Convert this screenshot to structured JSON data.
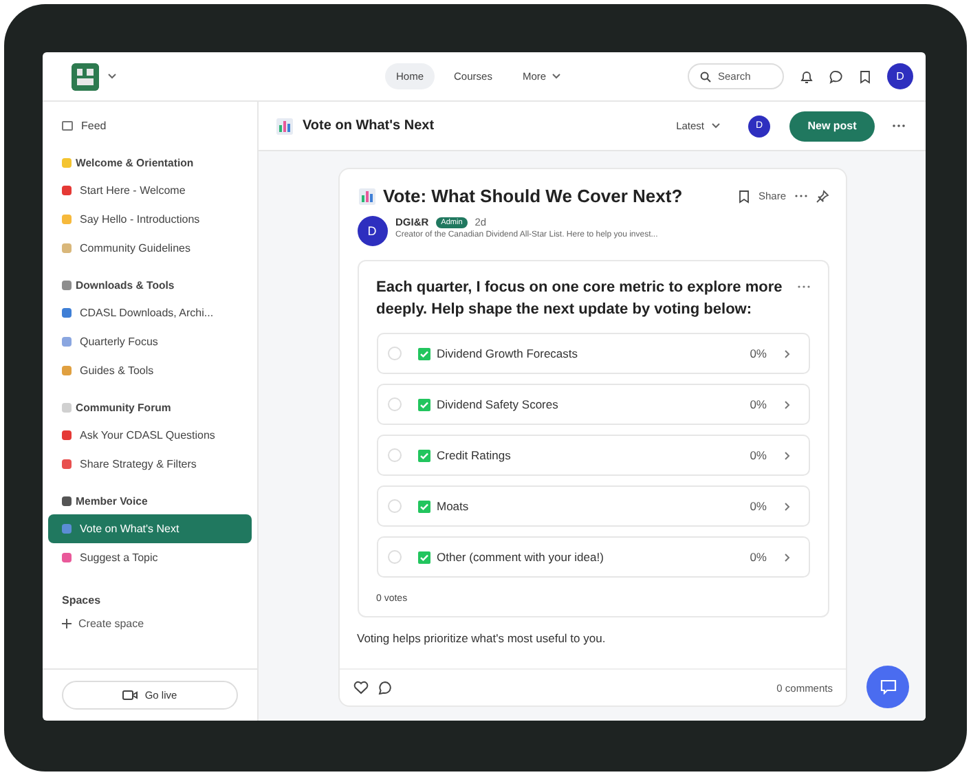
{
  "topbar": {
    "nav": [
      {
        "label": "Home",
        "selected": true,
        "dropdown": false
      },
      {
        "label": "Courses",
        "selected": false,
        "dropdown": false
      },
      {
        "label": "More",
        "selected": false,
        "dropdown": true
      }
    ],
    "search": {
      "placeholder": "Search"
    },
    "avatar": "D"
  },
  "sidebar": {
    "feed": "Feed",
    "sections": [
      {
        "title": "Welcome & Orientation",
        "items": [
          {
            "label": "Start Here - Welcome",
            "selected": false
          },
          {
            "label": "Say Hello - Introductions",
            "selected": false
          },
          {
            "label": "Community Guidelines",
            "selected": false
          }
        ]
      },
      {
        "title": "Downloads & Tools",
        "items": [
          {
            "label": "CDASL Downloads, Archi...",
            "selected": false
          },
          {
            "label": "Quarterly Focus",
            "selected": false
          },
          {
            "label": "Guides & Tools",
            "selected": false
          }
        ]
      },
      {
        "title": "Community Forum",
        "items": [
          {
            "label": "Ask Your CDASL Questions",
            "selected": false
          },
          {
            "label": "Share Strategy & Filters",
            "selected": false
          }
        ]
      },
      {
        "title": "Member Voice",
        "items": [
          {
            "label": "Vote on What's Next",
            "selected": true
          },
          {
            "label": "Suggest a Topic",
            "selected": false
          }
        ]
      }
    ],
    "spaces": {
      "title": "Spaces",
      "create": "Create space"
    },
    "go_live": "Go live"
  },
  "header": {
    "title": "Vote on What's Next",
    "sort": "Latest",
    "avatar": "D",
    "new_post": "New post"
  },
  "post": {
    "title": "Vote: What Should We Cover Next?",
    "share": "Share",
    "author": "DGI&R",
    "avatar": "D",
    "badge": "Admin",
    "time": "2d",
    "bio": "Creator of the Canadian Dividend All-Star List. Here to help you invest...",
    "poll": {
      "question": "Each quarter, I focus on one core metric to explore more deeply. Help shape the next update by voting below:",
      "options": [
        {
          "label": "Dividend Growth Forecasts",
          "percent": "0%",
          "selected": false
        },
        {
          "label": "Dividend Safety Scores",
          "percent": "0%",
          "selected": false
        },
        {
          "label": "Credit Ratings",
          "percent": "0%",
          "selected": false
        },
        {
          "label": "Moats",
          "percent": "0%",
          "selected": false
        },
        {
          "label": "Other (comment with your idea!)",
          "percent": "0%",
          "selected": false
        }
      ],
      "votes": "0 votes"
    },
    "body": "Voting helps prioritize what's most useful to you.",
    "comments": "0 comments"
  }
}
